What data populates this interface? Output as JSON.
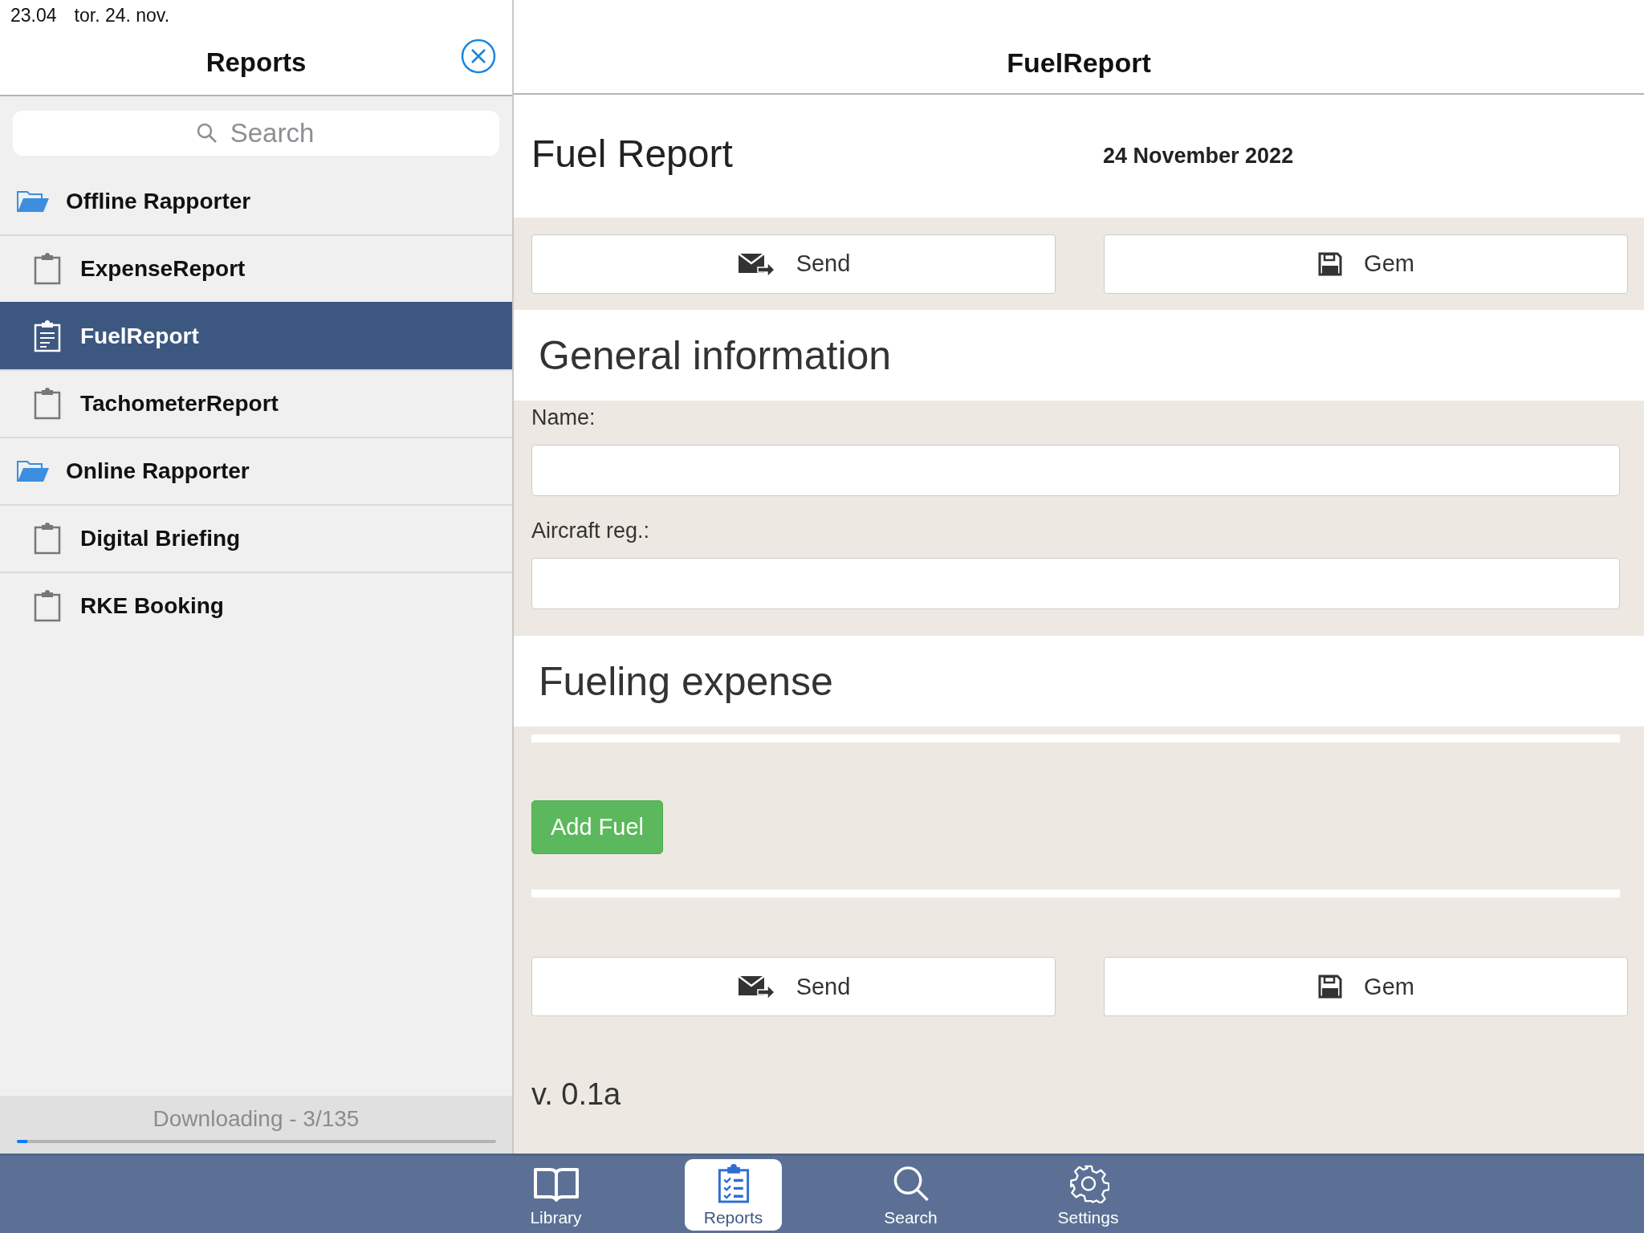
{
  "status_bar": {
    "time": "23.04",
    "date": "tor. 24. nov."
  },
  "sidebar": {
    "title": "Reports",
    "search": {
      "placeholder": "Search"
    },
    "folders": [
      {
        "label": "Offline Rapporter",
        "expanded": true,
        "children": [
          {
            "label": "ExpenseReport",
            "selected": false
          },
          {
            "label": "FuelReport",
            "selected": true
          },
          {
            "label": "TachometerReport",
            "selected": false
          }
        ]
      },
      {
        "label": "Online Rapporter",
        "expanded": true,
        "children": [
          {
            "label": "Digital Briefing",
            "selected": false
          },
          {
            "label": "RKE Booking",
            "selected": false
          }
        ]
      }
    ],
    "download": {
      "text": "Downloading - 3/135",
      "level": 0.022
    }
  },
  "main": {
    "nav_title": "FuelReport",
    "title": "Fuel Report",
    "date": "24 November 2022",
    "top_buttons": [
      {
        "kind": "send",
        "label": "Send"
      },
      {
        "kind": "save",
        "label": "Gem"
      }
    ],
    "sections": [
      {
        "title": "General information",
        "fields": [
          {
            "label": "Name:"
          },
          {
            "label": "Aircraft reg.:"
          }
        ]
      },
      {
        "title": "Fueling expense",
        "add_button": "Add Fuel"
      }
    ],
    "bottom_buttons": [
      {
        "kind": "send",
        "label": "Send"
      },
      {
        "kind": "save",
        "label": "Gem"
      }
    ],
    "version": "v. 0.1a"
  },
  "tab_bar": [
    {
      "kind": "book",
      "label": "Library",
      "selected": false
    },
    {
      "kind": "clipboard",
      "label": "Reports",
      "selected": true
    },
    {
      "kind": "search",
      "label": "Search",
      "selected": false
    },
    {
      "kind": "gear",
      "label": "Settings",
      "selected": false
    }
  ]
}
